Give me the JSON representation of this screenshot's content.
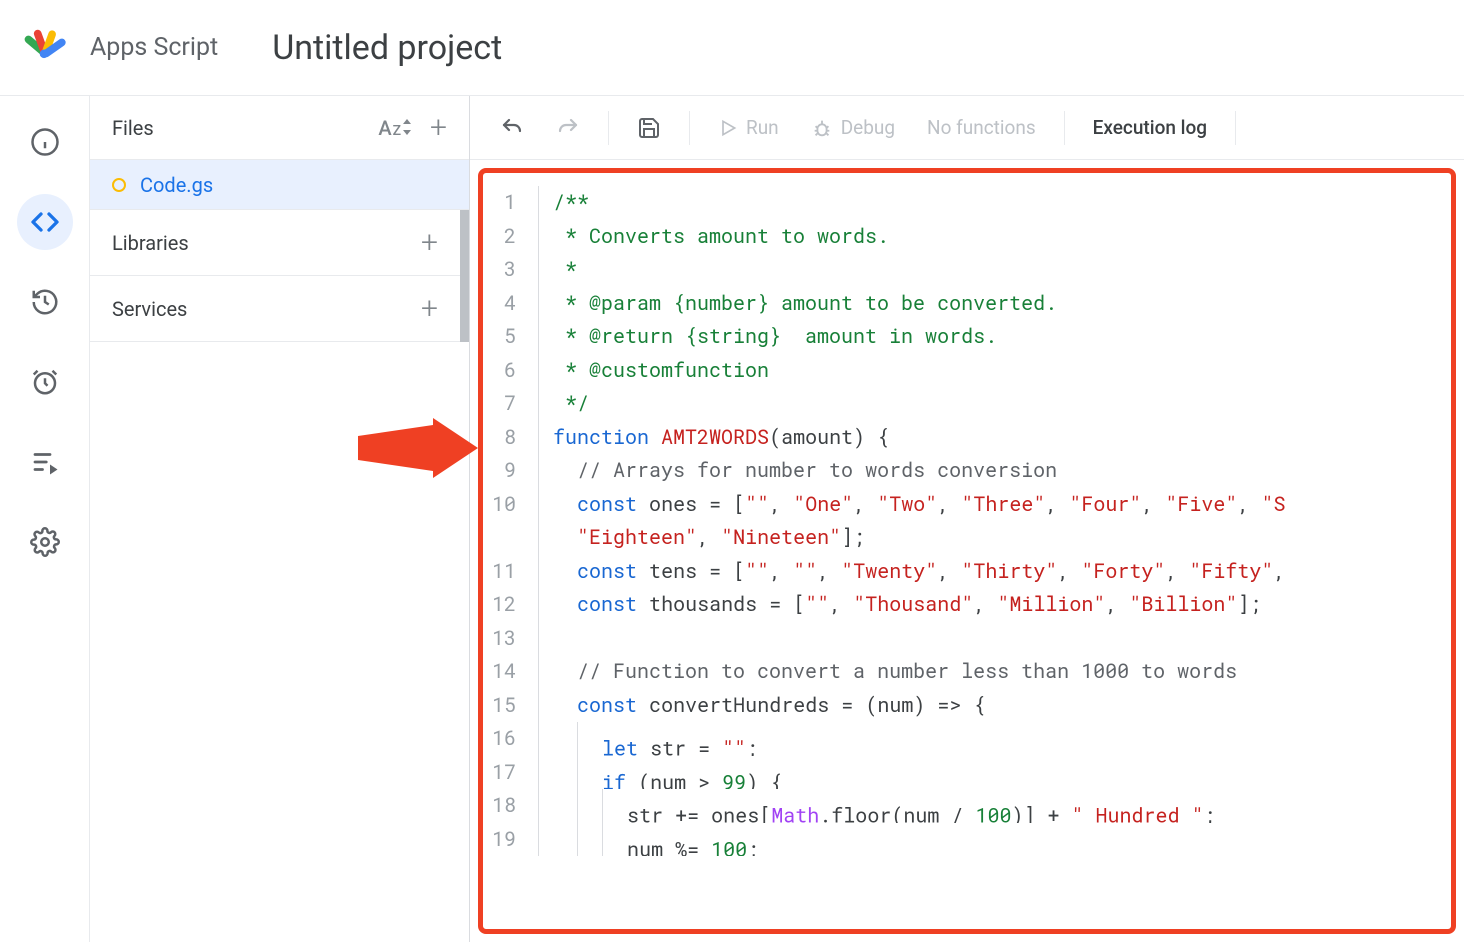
{
  "header": {
    "app_name": "Apps Script",
    "project_title": "Untitled project"
  },
  "file_panel": {
    "files_label": "Files",
    "file_name": "Code.gs",
    "libraries_label": "Libraries",
    "services_label": "Services"
  },
  "toolbar": {
    "run_label": "Run",
    "debug_label": "Debug",
    "func_select": "No functions",
    "exec_log": "Execution log"
  },
  "code": {
    "lines": [
      "/**",
      " * Converts amount to words.",
      " *",
      " * @param {number} amount to be converted.",
      " * @return {string}  amount in words.",
      " * @customfunction",
      " */",
      "function AMT2WORDS(amount) {",
      "  // Arrays for number to words conversion",
      "  const ones = [\"\", \"One\", \"Two\", \"Three\", \"Four\", \"Five\", \"S",
      "  \"Eighteen\", \"Nineteen\"];",
      "  const tens = [\"\", \"\", \"Twenty\", \"Thirty\", \"Forty\", \"Fifty\",",
      "  const thousands = [\"\", \"Thousand\", \"Million\", \"Billion\"];",
      "",
      "  // Function to convert a number less than 1000 to words",
      "  const convertHundreds = (num) => {",
      "    let str = \"\";",
      "    if (num > 99) {",
      "      str += ones[Math.floor(num / 100)] + \" Hundred \";",
      "      num %= 100;"
    ]
  }
}
